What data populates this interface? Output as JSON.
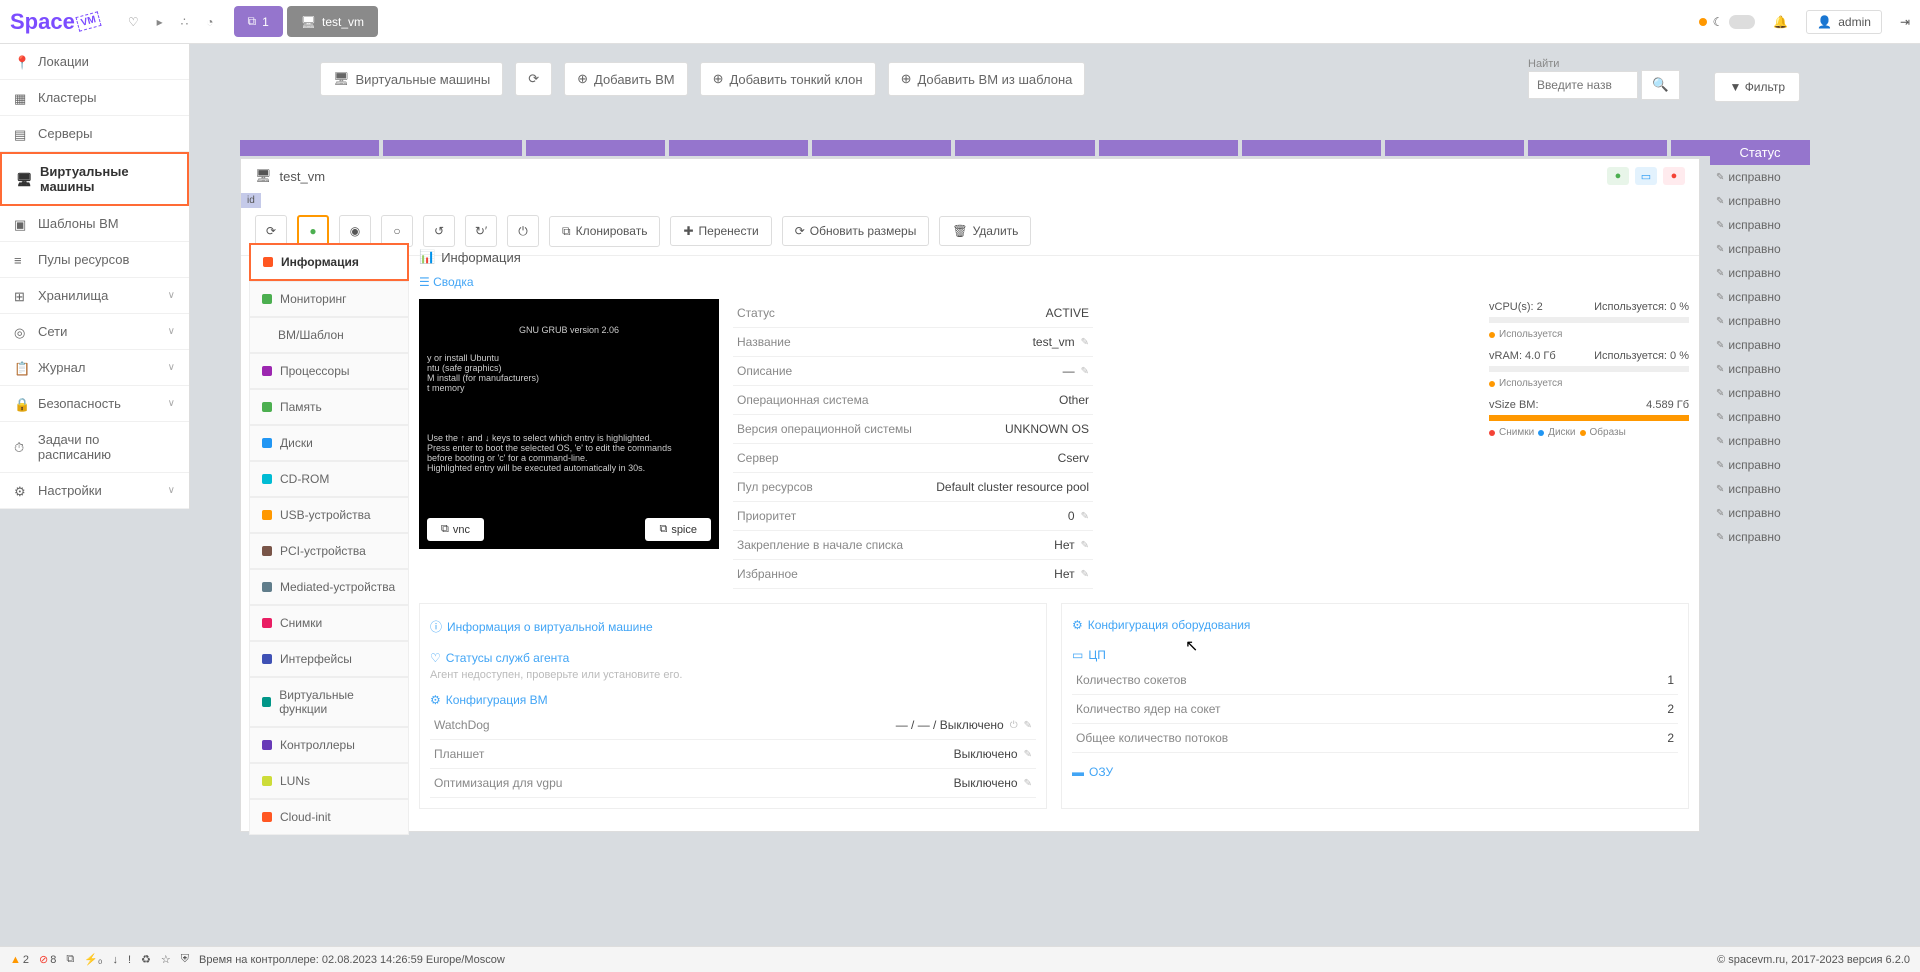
{
  "header": {
    "logo_main": "Space",
    "logo_badge": "VM",
    "tab1": "1",
    "tab2": "test_vm",
    "user": "admin"
  },
  "sidebar": {
    "items": [
      {
        "icon": "📍",
        "label": "Локации"
      },
      {
        "icon": "▦",
        "label": "Кластеры"
      },
      {
        "icon": "▤",
        "label": "Серверы"
      },
      {
        "icon": "🖥",
        "label": "Виртуальные машины",
        "active": true
      },
      {
        "icon": "▣",
        "label": "Шаблоны ВМ"
      },
      {
        "icon": "≡",
        "label": "Пулы ресурсов"
      },
      {
        "icon": "⊞",
        "label": "Хранилища",
        "chev": true
      },
      {
        "icon": "◎",
        "label": "Сети",
        "chev": true
      },
      {
        "icon": "📋",
        "label": "Журнал",
        "chev": true
      },
      {
        "icon": "🔒",
        "label": "Безопасность",
        "chev": true
      },
      {
        "icon": "⏱",
        "label": "Задачи по расписанию"
      },
      {
        "icon": "⚙",
        "label": "Настройки",
        "chev": true
      }
    ]
  },
  "toolbar": {
    "vms": "Виртуальные машины",
    "add_vm": "Добавить ВМ",
    "add_clone": "Добавить тонкий клон",
    "add_template": "Добавить ВМ из шаблона",
    "search_label": "Найти",
    "search_placeholder": "Введите назв",
    "filter": "Фильтр"
  },
  "status": {
    "header": "Статус",
    "text": "исправно",
    "rows": 16
  },
  "panel": {
    "title": "test_vm",
    "id_label": "id",
    "actions": {
      "clone": "Клонировать",
      "migrate": "Перенести",
      "resize": "Обновить размеры",
      "delete": "Удалить"
    }
  },
  "dtabs": [
    {
      "c": "#ff5722",
      "label": "Информация",
      "active": true
    },
    {
      "c": "#4caf50",
      "label": "Мониторинг"
    },
    {
      "c": "",
      "label": "ВМ/Шаблон",
      "indent": true
    },
    {
      "c": "#9c27b0",
      "label": "Процессоры"
    },
    {
      "c": "#4caf50",
      "label": "Память"
    },
    {
      "c": "#2196f3",
      "label": "Диски"
    },
    {
      "c": "#00bcd4",
      "label": "CD-ROM"
    },
    {
      "c": "#ff9800",
      "label": "USB-устройства"
    },
    {
      "c": "#795548",
      "label": "PCI-устройства"
    },
    {
      "c": "#607d8b",
      "label": "Mediated-устройства"
    },
    {
      "c": "#e91e63",
      "label": "Снимки"
    },
    {
      "c": "#3f51b5",
      "label": "Интерфейсы"
    },
    {
      "c": "#009688",
      "label": "Виртуальные функции"
    },
    {
      "c": "#673ab7",
      "label": "Контроллеры"
    },
    {
      "c": "#cddc39",
      "label": "LUNs"
    },
    {
      "c": "#ff5722",
      "label": "Cloud-init"
    }
  ],
  "info": {
    "title": "Информация",
    "summary": "Сводка",
    "console": {
      "grub": "GNU GRUB  version 2.06",
      "line1": "y or install Ubuntu",
      "line2": "ntu (safe graphics)",
      "line3": "M install (for manufacturers)",
      "line4": "t memory",
      "help1": "Use the ↑ and ↓ keys to select which entry is highlighted.",
      "help2": "Press enter to boot the selected OS, 'e' to edit the commands",
      "help3": "before booting or 'c' for a command-line.",
      "help4": "Highlighted entry will be executed automatically in 30s.",
      "vnc": "vnc",
      "spice": "spice"
    },
    "props": {
      "status_k": "Статус",
      "status_v": "ACTIVE",
      "name_k": "Название",
      "name_v": "test_vm",
      "desc_k": "Описание",
      "desc_v": "—",
      "os_k": "Операционная система",
      "os_v": "Other",
      "osver_k": "Версия операционной системы",
      "osver_v": "UNKNOWN OS",
      "server_k": "Сервер",
      "server_v": "Cserv",
      "pool_k": "Пул ресурсов",
      "pool_v": "Default cluster resource pool",
      "prio_k": "Приоритет",
      "prio_v": "0",
      "pin_k": "Закрепление в начале списка",
      "pin_v": "Нет",
      "fav_k": "Избранное",
      "fav_v": "Нет"
    },
    "resources": {
      "vcpu_k": "vCPU(s): 2",
      "vcpu_use": "Используется: 0 %",
      "used": "Используется",
      "vram_k": "vRAM: 4.0 Гб",
      "vram_use": "Используется: 0 %",
      "vsize_k": "vSize ВМ:",
      "vsize_v": "4.589 Гб",
      "legend_snaps": "Снимки",
      "legend_disks": "Диски",
      "legend_images": "Образы"
    },
    "vm_info_title": "Информация о виртуальной машине",
    "agent_title": "Статусы служб агента",
    "agent_warn": "Агент недоступен, проверьте или установите его.",
    "vm_config": "Конфигурация ВМ",
    "watchdog_k": "WatchDog",
    "watchdog_v": "— / — / Выключено",
    "tablet_k": "Планшет",
    "tablet_v": "Выключено",
    "vgpu_k": "Оптимизация для vgpu",
    "vgpu_v": "Выключено",
    "hw_config": "Конфигурация оборудования",
    "cpu_title": "ЦП",
    "sockets_k": "Количество сокетов",
    "sockets_v": "1",
    "cores_k": "Количество ядер на сокет",
    "cores_v": "2",
    "threads_k": "Общее количество потоков",
    "threads_v": "2",
    "ram_title": "ОЗУ"
  },
  "footer": {
    "warn_count": "2",
    "err_count": "8",
    "time": "Время на контроллере: 02.08.2023 14:26:59 Europe/Moscow",
    "copyright": "© spacevm.ru, 2017-2023 версия 6.2.0"
  }
}
